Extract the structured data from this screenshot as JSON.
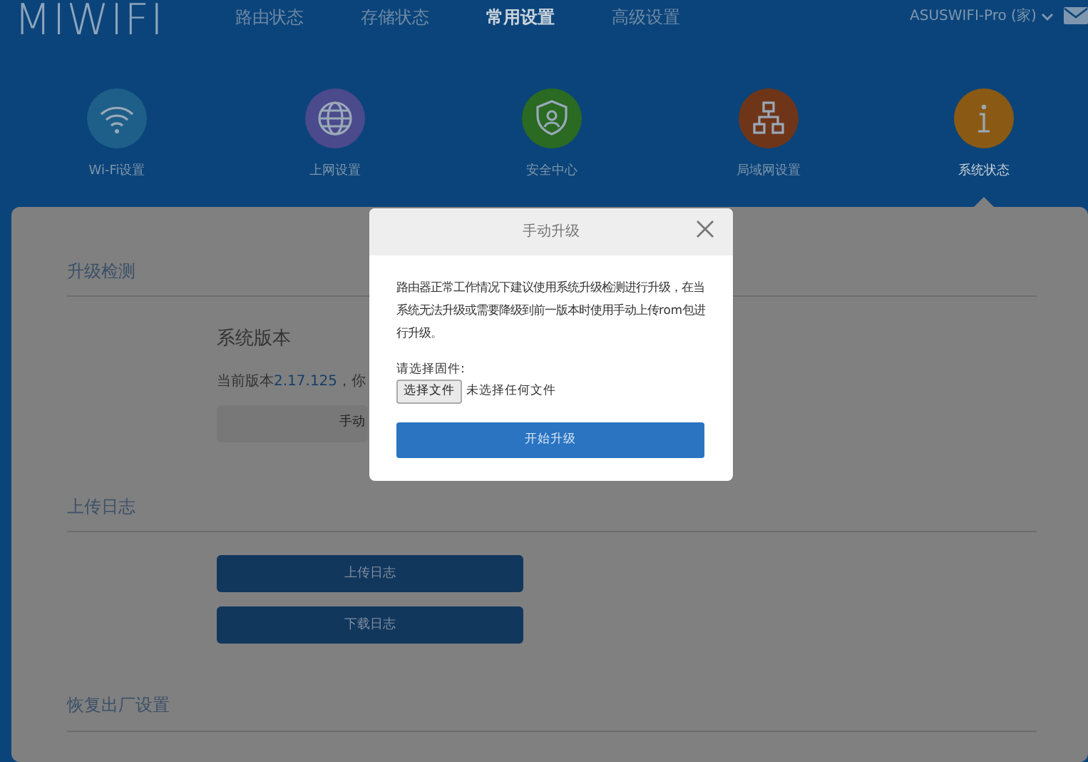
{
  "header": {
    "logo": "MIWIFI",
    "nav": [
      {
        "label": "路由状态",
        "selected": false
      },
      {
        "label": "存储状态",
        "selected": false
      },
      {
        "label": "常用设置",
        "selected": true
      },
      {
        "label": "高级设置",
        "selected": false
      }
    ],
    "account": "ASUSWIFI-Pro (家)"
  },
  "shortcuts": [
    {
      "kind": "wifi",
      "label": "Wi-Fi设置",
      "color": "#1e5f8a",
      "selected": false
    },
    {
      "kind": "globe",
      "label": "上网设置",
      "color": "#4b4a8c",
      "selected": false
    },
    {
      "kind": "shield",
      "label": "安全中心",
      "color": "#2a6a23",
      "selected": false
    },
    {
      "kind": "network",
      "label": "局域网设置",
      "color": "#6f3519",
      "selected": false
    },
    {
      "kind": "info",
      "label": "系统状态",
      "color": "#8a5a14",
      "selected": true
    }
  ],
  "sections": [
    {
      "title": "升级检测",
      "subtitle": "系统版本",
      "version_label": "当前版本",
      "version": "2.17.125",
      "version_suffix": "，你",
      "buttons": [
        {
          "label": "手动",
          "kind": "secondary"
        }
      ]
    },
    {
      "title": "上传日志",
      "buttons": [
        {
          "label": "上传日志",
          "kind": "primary"
        },
        {
          "label": "下载日志",
          "kind": "primary"
        }
      ]
    },
    {
      "title": "恢复出厂设置"
    }
  ],
  "dialog": {
    "title": "手动升级",
    "description": "路由器正常工作情况下建议使用系统升级检测进行升级，在当系统无法升级或需要降级到前一版本时使用手动上传rom包进行升级。",
    "file_label": "请选择固件:",
    "file_button": "选择文件",
    "file_status": "未选择任何文件",
    "submit": "开始升级"
  }
}
